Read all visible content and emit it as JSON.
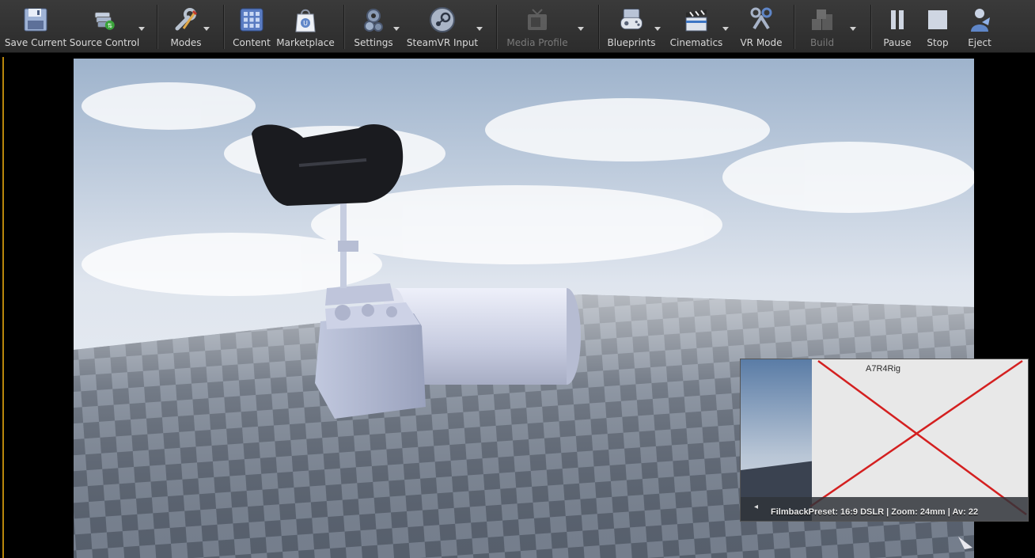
{
  "toolbar": {
    "buttons": [
      {
        "label": "Save Current",
        "icon": "save-icon"
      },
      {
        "label": "Source Control",
        "icon": "source-control-icon"
      },
      {
        "label": "Modes",
        "icon": "modes-icon"
      },
      {
        "label": "Content",
        "icon": "content-icon"
      },
      {
        "label": "Marketplace",
        "icon": "marketplace-icon"
      },
      {
        "label": "Settings",
        "icon": "settings-icon"
      },
      {
        "label": "SteamVR Input",
        "icon": "steamvr-icon"
      },
      {
        "label": "Media Profile",
        "icon": "media-profile-icon",
        "disabled": true
      },
      {
        "label": "Blueprints",
        "icon": "blueprints-icon"
      },
      {
        "label": "Cinematics",
        "icon": "cinematics-icon"
      },
      {
        "label": "VR Mode",
        "icon": "vr-mode-icon"
      },
      {
        "label": "Build",
        "icon": "build-icon",
        "disabled": true
      },
      {
        "label": "Pause",
        "icon": "pause-icon"
      },
      {
        "label": "Stop",
        "icon": "stop-icon"
      },
      {
        "label": "Eject",
        "icon": "eject-icon"
      }
    ]
  },
  "pip": {
    "title": "A7R4Rig",
    "caption": "FilmbackPreset: 16:9 DSLR | Zoom: 24mm | Av: 22"
  },
  "colors": {
    "toolbar_bg": "#2f2f2f",
    "viewport_border": "#b8860b",
    "pip_cross": "#d42020"
  }
}
